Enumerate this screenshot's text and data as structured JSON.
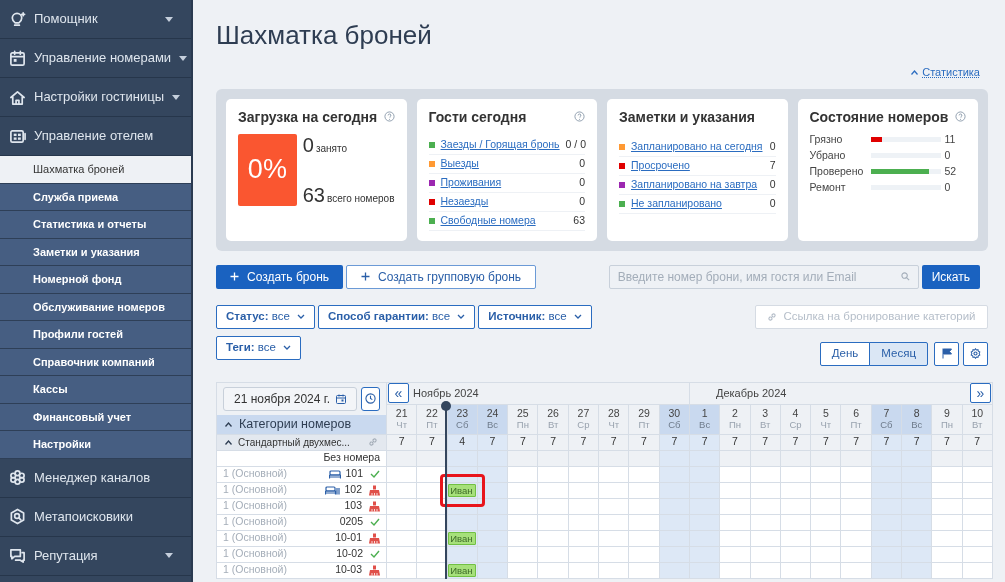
{
  "sidebar": {
    "items": [
      {
        "label": "Помощник",
        "caret": true
      },
      {
        "label": "Управление номерами",
        "caret": true
      },
      {
        "label": "Настройки гостиницы",
        "caret": true
      },
      {
        "label": "Управление отелем",
        "caret": false,
        "children": [
          {
            "label": "Шахматка броней",
            "selected": true
          },
          {
            "label": "Служба приема",
            "selected": false
          },
          {
            "label": "Статистика и отчеты",
            "selected": false
          },
          {
            "label": "Заметки и указания",
            "selected": false
          },
          {
            "label": "Номерной фонд",
            "selected": false
          },
          {
            "label": "Обслуживание номеров",
            "selected": false
          },
          {
            "label": "Профили гостей",
            "selected": false
          },
          {
            "label": "Справочник компаний",
            "selected": false
          },
          {
            "label": "Кассы",
            "selected": false
          },
          {
            "label": "Финансовый учет",
            "selected": false
          },
          {
            "label": "Настройки",
            "selected": false
          }
        ]
      },
      {
        "label": "Менеджер каналов",
        "caret": false
      },
      {
        "label": "Метапоисковики",
        "caret": false
      },
      {
        "label": "Репутация",
        "caret": true
      }
    ]
  },
  "page": {
    "title": "Шахматка броней",
    "stats_link": "Статистика"
  },
  "cards": {
    "occupancy": {
      "title": "Загрузка на сегодня",
      "percent": "0%",
      "occupied": "0",
      "occupied_label": "занято",
      "total": "63",
      "total_label": "всего номеров"
    },
    "guests": {
      "title": "Гости сегодня",
      "rows": [
        {
          "label": "Заезды / Горящая бронь",
          "value": "0 / 0",
          "color": "#4caf50"
        },
        {
          "label": "Выезды",
          "value": "0",
          "color": "#ff9933"
        },
        {
          "label": "Проживания",
          "value": "0",
          "color": "#9c27b0"
        },
        {
          "label": "Незаезды",
          "value": "0",
          "color": "#e00000"
        },
        {
          "label": "Свободные номера",
          "value": "63",
          "color": "#4caf50"
        }
      ]
    },
    "notes": {
      "title": "Заметки и указания",
      "rows": [
        {
          "label": "Запланировано на сегодня",
          "value": "0",
          "color": "#ff9933"
        },
        {
          "label": "Просрочено",
          "value": "7",
          "color": "#e00000"
        },
        {
          "label": "Запланировано на завтра",
          "value": "0",
          "color": "#9c27b0"
        },
        {
          "label": "Не запланировано",
          "value": "0",
          "color": "#4caf50"
        }
      ]
    },
    "room_status": {
      "title": "Состояние номеров",
      "rows": [
        {
          "label": "Грязно",
          "value": "11",
          "level": 0.17,
          "color": "#e00000"
        },
        {
          "label": "Убрано",
          "value": "0"
        },
        {
          "label": "Проверено",
          "value": "52",
          "level": 0.83,
          "color": "#4caf50"
        },
        {
          "label": "Ремонт",
          "value": "0"
        }
      ]
    }
  },
  "toolbar": {
    "create": "Создать бронь",
    "create_group": "Создать групповую бронь",
    "search": {
      "placeholder": "Введите номер брони, имя гостя или Email"
    },
    "search_button": "Искать"
  },
  "filters": [
    {
      "label": "Статус:",
      "value": "все"
    },
    {
      "label": "Способ гарантии:",
      "value": "все"
    },
    {
      "label": "Источник:",
      "value": "все"
    },
    {
      "label": "Теги:",
      "value": "все"
    }
  ],
  "booking_link": {
    "label": "Ссылка на бронирование категорий",
    "disabled": true
  },
  "views": [
    {
      "label": "День",
      "selected": false
    },
    {
      "label": "Месяц",
      "selected": true
    }
  ],
  "grid": {
    "date": "21 ноября 2024 г.",
    "categories_label": "Категории номеров",
    "prev": "«",
    "next": "»",
    "months": [
      {
        "label": "Ноябрь 2024",
        "days": [
          {
            "date": "21",
            "weekday": "Чт",
            "weekend": false,
            "today": false,
            "free": "7"
          },
          {
            "date": "22",
            "weekday": "Пт",
            "weekend": false,
            "today": true,
            "free": "7"
          },
          {
            "date": "23",
            "weekday": "Сб",
            "weekend": true,
            "today": false,
            "free": "4",
            "booking_column": true
          },
          {
            "date": "24",
            "weekday": "Вс",
            "weekend": true,
            "today": false,
            "free": "7"
          },
          {
            "date": "25",
            "weekday": "Пн",
            "weekend": false,
            "today": false,
            "free": "7"
          },
          {
            "date": "26",
            "weekday": "Вт",
            "weekend": false,
            "today": false,
            "free": "7"
          },
          {
            "date": "27",
            "weekday": "Ср",
            "weekend": false,
            "today": false,
            "free": "7"
          },
          {
            "date": "28",
            "weekday": "Чт",
            "weekend": false,
            "today": false,
            "free": "7"
          },
          {
            "date": "29",
            "weekday": "Пт",
            "weekend": false,
            "today": false,
            "free": "7"
          },
          {
            "date": "30",
            "weekday": "Сб",
            "weekend": true,
            "today": false,
            "free": "7"
          }
        ]
      },
      {
        "label": "Декабрь 2024",
        "days": [
          {
            "date": "1",
            "weekday": "Вс",
            "weekend": true,
            "today": false,
            "free": "7"
          },
          {
            "date": "2",
            "weekday": "Пн",
            "weekend": false,
            "today": false,
            "free": "7"
          },
          {
            "date": "3",
            "weekday": "Вт",
            "weekend": false,
            "today": false,
            "free": "7"
          },
          {
            "date": "4",
            "weekday": "Ср",
            "weekend": false,
            "today": false,
            "free": "7"
          },
          {
            "date": "5",
            "weekday": "Чт",
            "weekend": false,
            "today": false,
            "free": "7"
          },
          {
            "date": "6",
            "weekday": "Пт",
            "weekend": false,
            "today": false,
            "free": "7"
          },
          {
            "date": "7",
            "weekday": "Сб",
            "weekend": true,
            "today": false,
            "free": "7"
          },
          {
            "date": "8",
            "weekday": "Вс",
            "weekend": true,
            "today": false,
            "free": "7"
          },
          {
            "date": "9",
            "weekday": "Пн",
            "weekend": false,
            "today": false,
            "free": "7"
          },
          {
            "date": "10",
            "weekday": "Вт",
            "weekend": false,
            "today": false,
            "free": "7"
          }
        ]
      }
    ],
    "category": {
      "name": "Стандартный двухмес...",
      "expanded": true
    },
    "unassigned_label": "Без номера",
    "rooms": [
      {
        "rate": "1 (Основной)",
        "number": "101",
        "bed_icon": true,
        "two_beds_icon": false,
        "dirty": false
      },
      {
        "rate": "1 (Основной)",
        "number": "102",
        "bed_icon": false,
        "two_beds_icon": true,
        "dirty": true,
        "booking": {
          "guest": "Иван",
          "highlighted": true
        }
      },
      {
        "rate": "1 (Основной)",
        "number": "103",
        "bed_icon": false,
        "two_beds_icon": false,
        "dirty": true
      },
      {
        "rate": "1 (Основной)",
        "number": "0205",
        "bed_icon": false,
        "two_beds_icon": false,
        "dirty": false
      },
      {
        "rate": "1 (Основной)",
        "number": "10-01",
        "bed_icon": false,
        "two_beds_icon": false,
        "dirty": true,
        "booking": {
          "guest": "Иван",
          "highlighted": false
        }
      },
      {
        "rate": "1 (Основной)",
        "number": "10-02",
        "bed_icon": false,
        "two_beds_icon": false,
        "dirty": false
      },
      {
        "rate": "1 (Основной)",
        "number": "10-03",
        "bed_icon": false,
        "two_beds_icon": false,
        "dirty": true,
        "booking": {
          "guest": "Иван",
          "highlighted": false
        }
      }
    ]
  }
}
